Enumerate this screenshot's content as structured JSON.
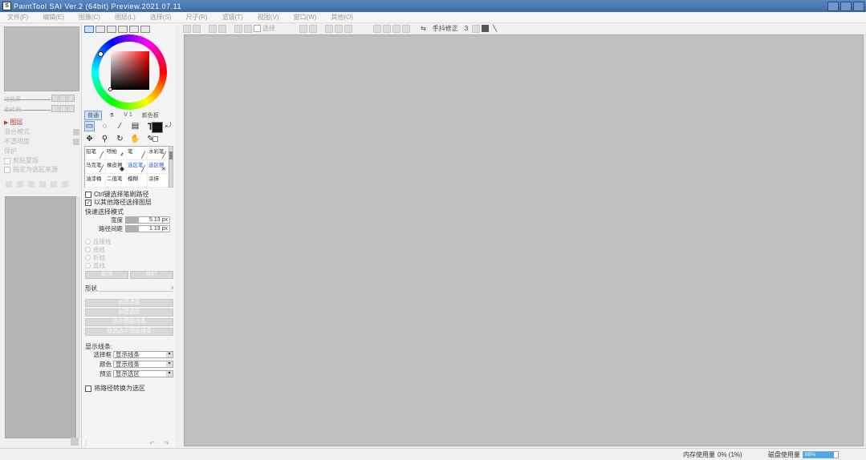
{
  "window": {
    "title": "PaintTool SAI Ver.2 (64bit) Preview.2021.07.11",
    "icon": "app-icon"
  },
  "menu": [
    "文件(F)",
    "编辑(E)",
    "图像(C)",
    "图层(L)",
    "选择(S)",
    "尺子(R)",
    "滤镜(T)",
    "视图(V)",
    "窗口(W)",
    "其他(O)"
  ],
  "toolbar": {
    "check_label": "选择",
    "hand_label": "手抖修正",
    "hand_value": "3"
  },
  "left_panel": {
    "zoom_label": "缩放率",
    "angle_label": "旋转角",
    "layer_tab": "图层",
    "blend_label": "混合模式",
    "opacity_label": "不透明度",
    "protect_label": "保护",
    "clip_check": "剪贴蒙版",
    "ref_check": "指定为选区来源"
  },
  "tool_panel": {
    "side_tabs": [
      "普通",
      "",
      "V 1",
      "颜色板"
    ],
    "main_tools": [
      "select-rect-icon",
      "lasso-icon",
      "magic-wand-icon",
      "layer-move-icon",
      "text-icon",
      "move-icon",
      "zoom-icon",
      "rotate-icon",
      "hand-icon",
      "eyedropper-icon"
    ],
    "brushes": [
      {
        "name": "铅笔",
        "blue": false
      },
      {
        "name": "喷枪",
        "blue": false
      },
      {
        "name": "笔",
        "blue": false
      },
      {
        "name": "水彩笔",
        "blue": false
      },
      {
        "name": "马克笔",
        "blue": false
      },
      {
        "name": "橡皮擦",
        "blue": false
      },
      {
        "name": "选区笔",
        "blue": true
      },
      {
        "name": "选区擦",
        "blue": true
      },
      {
        "name": "油漆桶",
        "blue": false
      },
      {
        "name": "二值笔",
        "blue": false
      },
      {
        "name": "模糊",
        "blue": false
      },
      {
        "name": "涂抹",
        "blue": false
      }
    ],
    "ctrl_check": "Ctrl键选择笔刷路径",
    "ctrl_checked": false,
    "alt_check": "以其他路径选择图层",
    "alt_checked": true,
    "size_section": "快速选择模式",
    "width_label": "宽度",
    "width_value": "5.13 px",
    "spacing_label": "路径间距",
    "spacing_value": "1.13 px",
    "radio_options": [
      "连接线",
      "曲线",
      "折线",
      "直线"
    ],
    "button_left": "取消",
    "button_right": "执行",
    "select_label": "形状",
    "gray_buttons": [
      "创建选区",
      "创建选区",
      "选中图层线条",
      "取消选中图层线条"
    ],
    "detail_title": "显示线条:",
    "sel_rows": [
      {
        "label": "选择框",
        "value": "显示线条"
      },
      {
        "label": "颜色",
        "value": "显示线条"
      },
      {
        "label": "预览",
        "value": "显示选区"
      }
    ],
    "bottom_check": "将路径转换为选区"
  },
  "status": {
    "memory_label": "内存使用量",
    "memory_value": "0% (1%)",
    "disk_label": "磁盘使用量",
    "disk_value": "88%",
    "disk_percent": 88
  }
}
